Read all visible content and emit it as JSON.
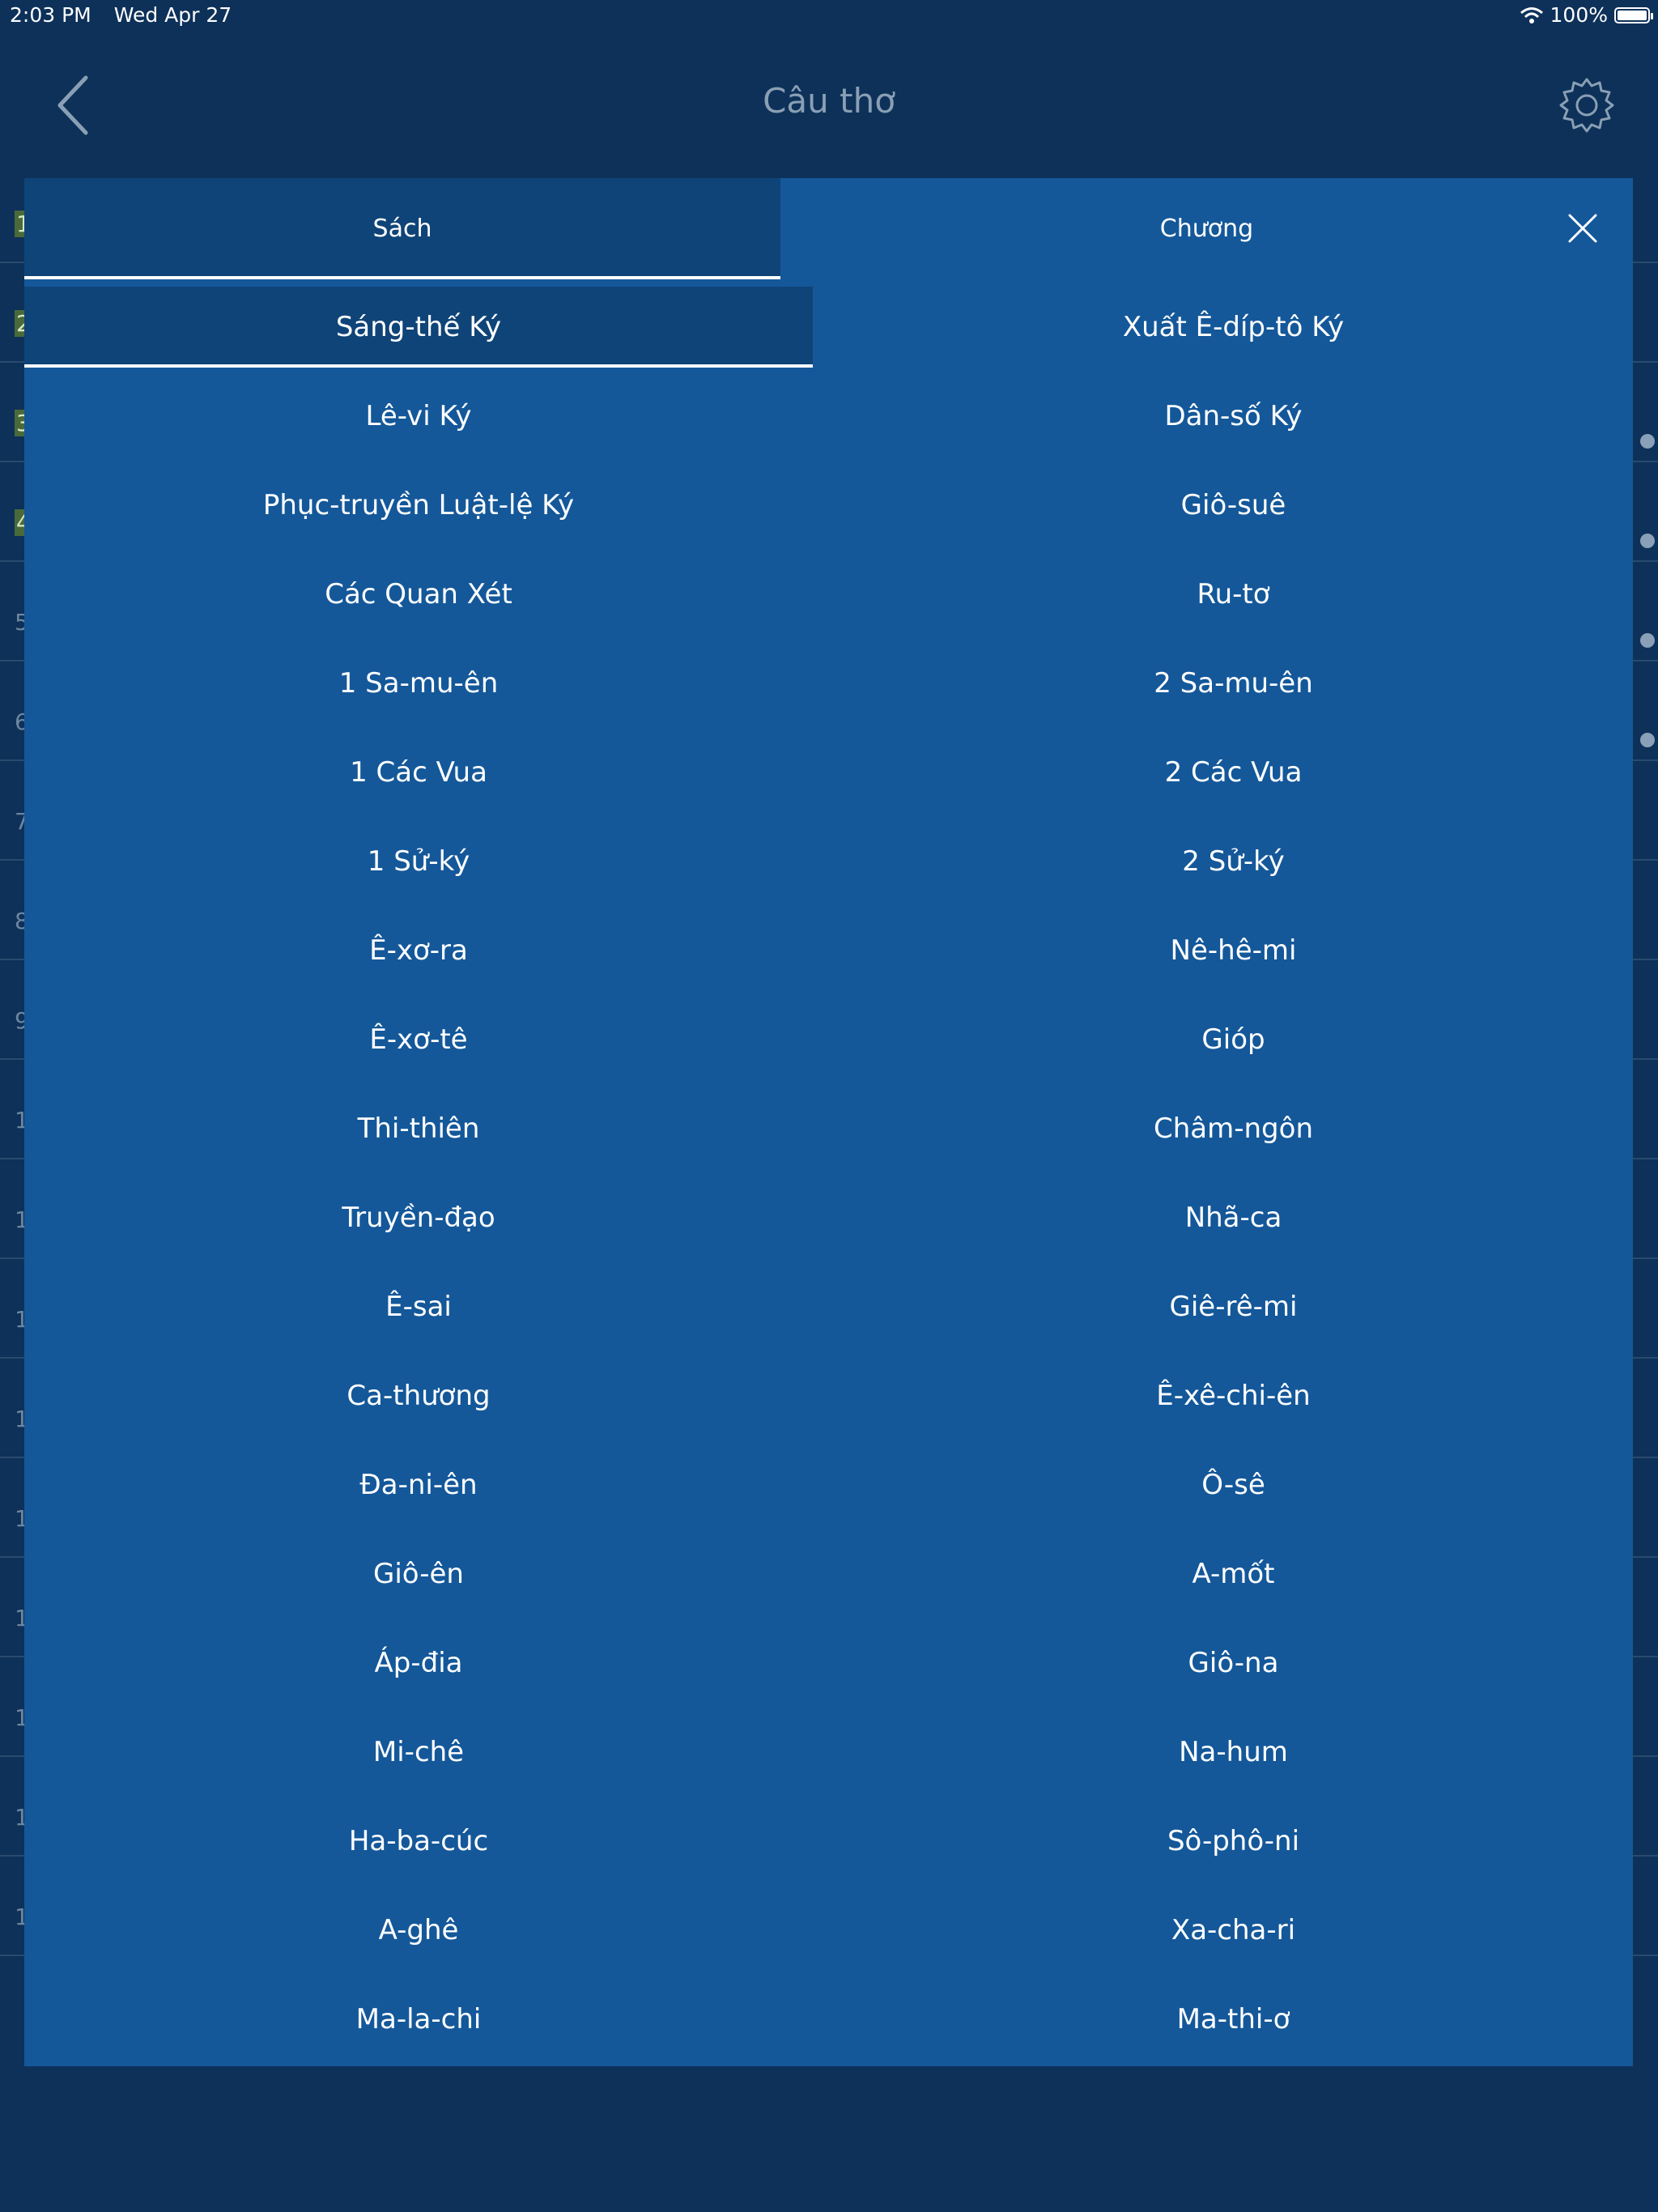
{
  "status_bar": {
    "time": "2:03 PM",
    "date": "Wed Apr 27",
    "battery": "100%"
  },
  "nav": {
    "title": "Câu thơ"
  },
  "background_numbers": [
    "1",
    "2",
    "3",
    "4",
    "5",
    "6",
    "7",
    "8",
    "9",
    "1",
    "1",
    "1",
    "1",
    "1",
    "1",
    "1",
    "1",
    "1"
  ],
  "tabs": {
    "books": "Sách",
    "chapters": "Chương"
  },
  "books": [
    "Sáng-thế Ký",
    "Xuất Ê-díp-tô Ký",
    "Lê-vi Ký",
    "Dân-số Ký",
    "Phục-truyền Luật-lệ Ký",
    "Giô-suê",
    "Các Quan Xét",
    "Ru-tơ",
    "1 Sa-mu-ên",
    "2 Sa-mu-ên",
    "1 Các Vua",
    "2 Các Vua",
    "1 Sử-ký",
    "2 Sử-ký",
    "Ê-xơ-ra",
    "Nê-hê-mi",
    "Ê-xơ-tê",
    "Gióp",
    "Thi-thiên",
    "Châm-ngôn",
    "Truyền-đạo",
    "Nhã-ca",
    "Ê-sai",
    "Giê-rê-mi",
    "Ca-thương",
    "Ê-xê-chi-ên",
    "Đa-ni-ên",
    "Ô-sê",
    "Giô-ên",
    "A-mốt",
    "Áp-đia",
    "Giô-na",
    "Mi-chê",
    "Na-hum",
    "Ha-ba-cúc",
    "Sô-phô-ni",
    "A-ghê",
    "Xa-cha-ri",
    "Ma-la-chi",
    "Ma-thi-ơ"
  ],
  "selected_book_index": 0,
  "colors": {
    "background": "#0d3159",
    "modal": "#14589a",
    "tab_active": "#0f4478",
    "title": "#8a9fb4"
  }
}
